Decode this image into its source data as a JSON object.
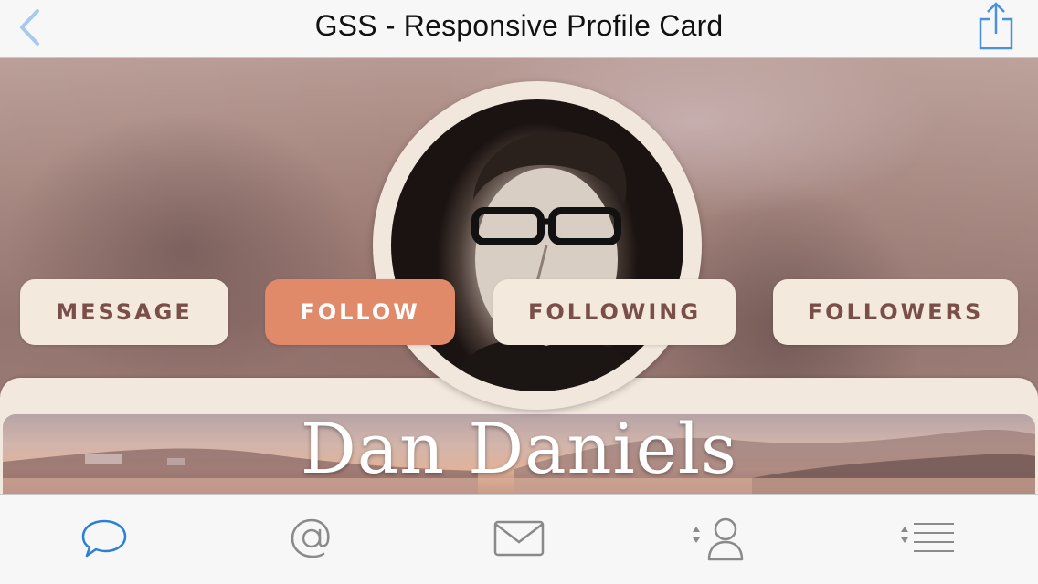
{
  "nav": {
    "title": "GSS - Responsive Profile Card",
    "back_icon": "chevron-left-icon",
    "share_icon": "share-icon",
    "accent_color": "#4a90e2"
  },
  "profile": {
    "name": "Dan Daniels"
  },
  "actions": {
    "message": "MESSAGE",
    "follow": "FOLLOW",
    "following": "FOLLOWING",
    "followers": "FOLLOWERS",
    "active": "FOLLOW",
    "active_color": "#e08a6a"
  },
  "tabs": [
    {
      "icon": "chat-bubble-icon",
      "selected": true
    },
    {
      "icon": "at-sign-icon",
      "selected": false
    },
    {
      "icon": "envelope-icon",
      "selected": false
    },
    {
      "icon": "person-sort-icon",
      "selected": false
    },
    {
      "icon": "list-sort-icon",
      "selected": false
    }
  ]
}
